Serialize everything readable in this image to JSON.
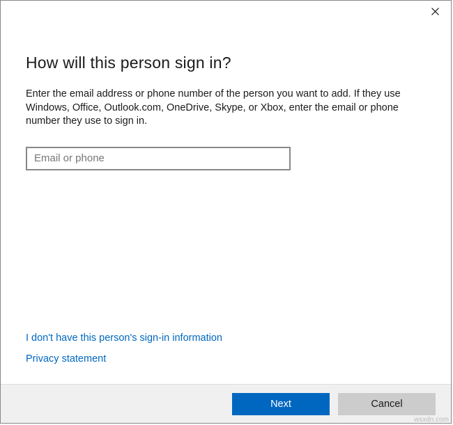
{
  "heading": "How will this person sign in?",
  "description": "Enter the email address or phone number of the person you want to add. If they use Windows, Office, Outlook.com, OneDrive, Skype, or Xbox, enter the email or phone number they use to sign in.",
  "input": {
    "placeholder": "Email or phone",
    "value": ""
  },
  "links": {
    "no_info": "I don't have this person's sign-in information",
    "privacy": "Privacy statement"
  },
  "buttons": {
    "next": "Next",
    "cancel": "Cancel"
  },
  "watermark": "wsxdn.com"
}
